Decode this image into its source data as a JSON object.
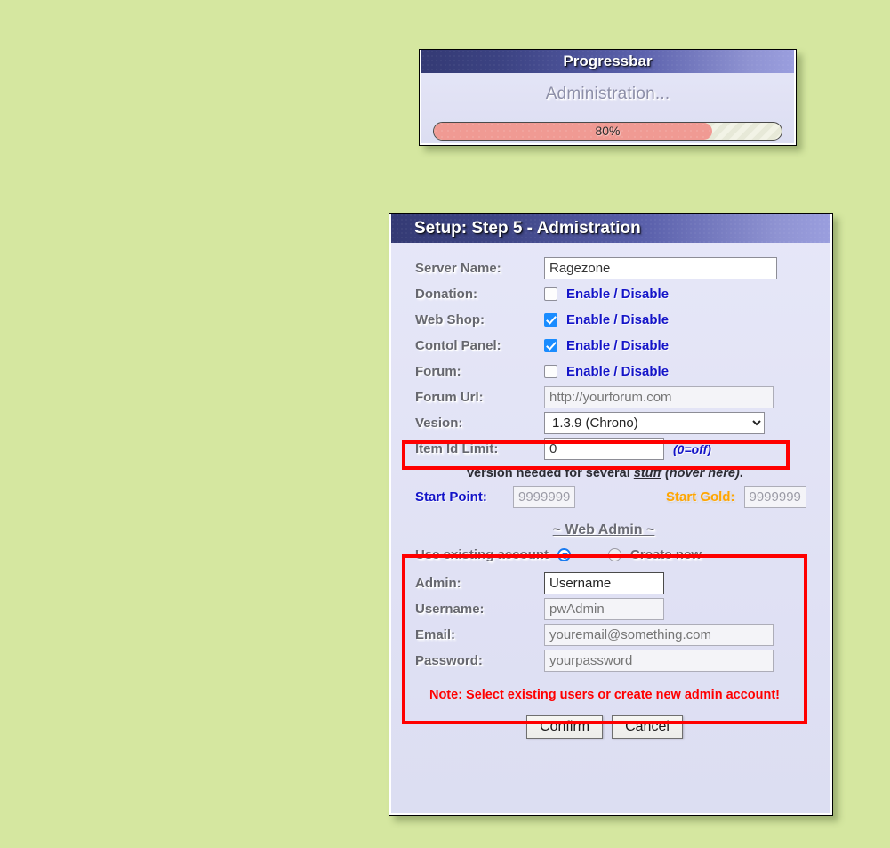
{
  "progress_dialog": {
    "title": "Progressbar",
    "status": "Administration...",
    "percent_label": "80%",
    "percent_value": 80
  },
  "setup_dialog": {
    "title": "Setup: Step 5 - Admistration",
    "fields": {
      "server_name_label": "Server Name:",
      "server_name_value": "Ragezone",
      "donation_label": "Donation:",
      "donation_toggle_text": "Enable / Disable",
      "donation_checked": false,
      "web_shop_label": "Web Shop:",
      "web_shop_toggle_text": "Enable / Disable",
      "web_shop_checked": true,
      "control_panel_label": "Contol Panel:",
      "control_panel_toggle_text": "Enable / Disable",
      "control_panel_checked": true,
      "forum_label": "Forum:",
      "forum_toggle_text": "Enable / Disable",
      "forum_checked": false,
      "forum_url_label": "Forum Url:",
      "forum_url_placeholder": "http://yourforum.com",
      "version_label": "Vesion:",
      "version_selected": "1.3.9 (Chrono)",
      "version_options": [
        "1.3.9 (Chrono)"
      ],
      "item_id_limit_label": "Item Id Limit:",
      "item_id_limit_value": "0",
      "item_id_limit_hint": "(0=off)",
      "version_note_prefix": "Version needed for several ",
      "version_note_stuff": "stuff",
      "version_note_suffix": "(hover here)",
      "version_note_end": ".",
      "start_point_label": "Start Point:",
      "start_point_value": "9999999",
      "start_gold_label": "Start Gold:",
      "start_gold_value": "9999999"
    },
    "web_admin": {
      "section_title": "~ Web Admin ~",
      "use_existing_label": "Use existing account",
      "use_existing_selected": true,
      "create_new_label": "Create new",
      "create_new_selected": false,
      "admin_label": "Admin:",
      "admin_value": "Username",
      "username_label": "Username:",
      "username_placeholder": "pwAdmin",
      "email_label": "Email:",
      "email_placeholder": "youremail@something.com",
      "password_label": "Password:",
      "password_placeholder": "yourpassword"
    },
    "note": "Note: Select existing users or create new admin account!",
    "buttons": {
      "confirm": "Confirm",
      "cancel": "Cancel"
    }
  }
}
